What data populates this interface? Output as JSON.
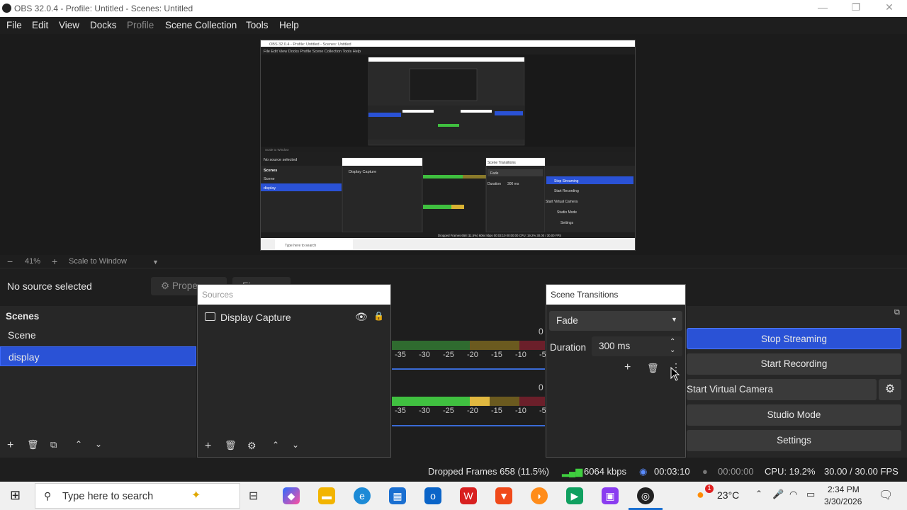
{
  "window": {
    "title": "OBS 32.0.4 - Profile: Untitled - Scenes: Untitled",
    "controls": [
      "—",
      "❐",
      "✕"
    ]
  },
  "menu": [
    {
      "label": "File",
      "enabled": true
    },
    {
      "label": "Edit",
      "enabled": true
    },
    {
      "label": "View",
      "enabled": true
    },
    {
      "label": "Docks",
      "enabled": true
    },
    {
      "label": "Profile",
      "enabled": false
    },
    {
      "label": "Scene Collection",
      "enabled": true
    },
    {
      "label": "Tools",
      "enabled": true
    },
    {
      "label": "Help",
      "enabled": true
    }
  ],
  "zoom": {
    "minus": "−",
    "value": "41%",
    "plus": "+",
    "mode": "Scale to Window"
  },
  "context": {
    "no_source": "No source selected",
    "properties": "Prope",
    "filters": "Fi"
  },
  "scenes": {
    "title": "Scenes",
    "items": [
      {
        "label": "Scene",
        "selected": false
      },
      {
        "label": "display",
        "selected": true
      }
    ]
  },
  "sources": {
    "title": "Sources",
    "items": [
      {
        "label": "Display Capture",
        "visible": true,
        "locked": true
      }
    ]
  },
  "mixer": {
    "zero_labels": [
      "0",
      "0"
    ],
    "scale": [
      "-35",
      "-30",
      "-25",
      "-20",
      "-15",
      "-10",
      "-5"
    ]
  },
  "transitions": {
    "title": "Scene Transitions",
    "selected": "Fade",
    "duration_label": "Duration",
    "duration_value": "300 ms"
  },
  "controls": {
    "stop_streaming": "Stop Streaming",
    "start_recording": "Start Recording",
    "start_virtual_camera": "Start Virtual Camera",
    "studio_mode": "Studio Mode",
    "settings": "Settings"
  },
  "status": {
    "dropped_frames": "Dropped Frames 658 (11.5%)",
    "bitrate": "6064 kbps",
    "stream_time": "00:03:10",
    "record_time": "00:00:00",
    "cpu": "CPU: 19.2%",
    "fps": "30.00 / 30.00 FPS"
  },
  "taskbar": {
    "search_placeholder": "Type here to search",
    "weather": "23°C",
    "weather_badge": "1",
    "time": "2:34 PM",
    "date": "3/30/2026"
  },
  "preview_thumb": {
    "title": "OBS 32.0.4 - Profile: Untitled - Scenes: Untitled",
    "menu": "File  Edit  View  Docks  Profile  Scene Collection  Tools  Help",
    "no_source": "No source selected",
    "scenes_label": "Scenes",
    "scene1": "Scene",
    "scene2": "display",
    "source": "Display Capture",
    "transitions_title": "Scene Transitions",
    "fade": "Fade",
    "duration": "Duration",
    "duration_value": "300 ms",
    "stop": "Stop Streaming",
    "rec": "Start Recording",
    "vcam": "Start Virtual Camera",
    "studio": "Studio Mode",
    "settings": "Settings",
    "status": "Dropped Frames 658 (11.5%)    6064 kbps    00:03:10    00:00:00    CPU: 19.2%    30.00 / 30.00 FPS",
    "search": "Type here to search",
    "zoom": "Scale to Window"
  }
}
